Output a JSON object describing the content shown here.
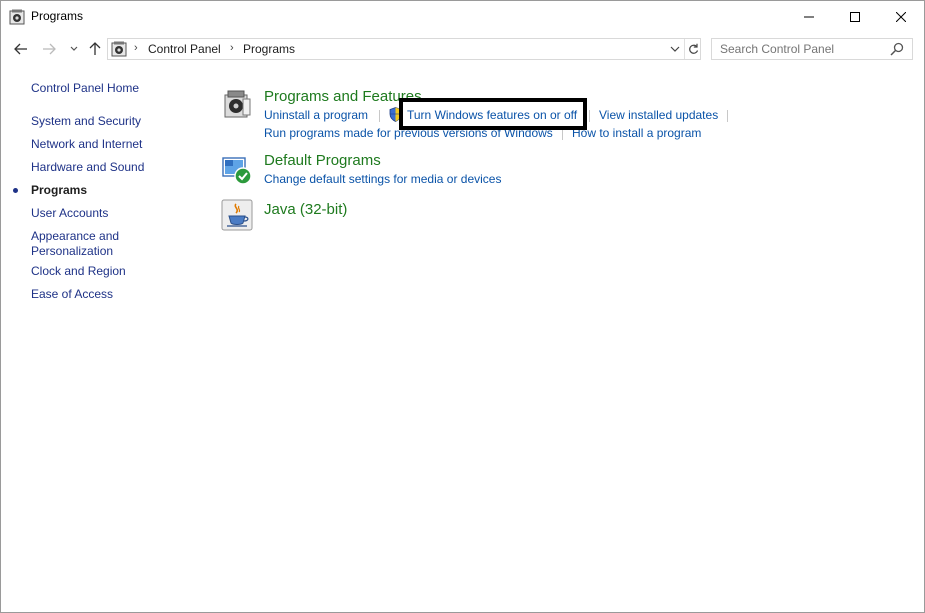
{
  "window": {
    "title": "Programs"
  },
  "address": {
    "crumbs": [
      "Control Panel",
      "Programs"
    ]
  },
  "search": {
    "placeholder": "Search Control Panel"
  },
  "sidebar": {
    "items": [
      {
        "label": "Control Panel Home"
      },
      {
        "label": "System and Security"
      },
      {
        "label": "Network and Internet"
      },
      {
        "label": "Hardware and Sound"
      },
      {
        "label": "Programs",
        "active": true
      },
      {
        "label": "User Accounts"
      },
      {
        "label": "Appearance and\nPersonalization"
      },
      {
        "label": "Clock and Region"
      },
      {
        "label": "Ease of Access"
      }
    ]
  },
  "main": {
    "categories": [
      {
        "title": "Programs and Features",
        "icon": "programs-features-icon",
        "links": [
          "Uninstall a program",
          "Turn Windows features on or off",
          "View installed updates",
          "Run programs made for previous versions of Windows",
          "How to install a program"
        ]
      },
      {
        "title": "Default Programs",
        "icon": "default-programs-icon",
        "links": [
          "Change default settings for media or devices"
        ]
      },
      {
        "title": "Java (32-bit)",
        "icon": "java-icon",
        "links": []
      }
    ]
  },
  "colors": {
    "category_title": "#1e7a1e",
    "link": "#0a53a8",
    "sidebar_link": "#1e3287",
    "highlight_border": "#000000"
  }
}
